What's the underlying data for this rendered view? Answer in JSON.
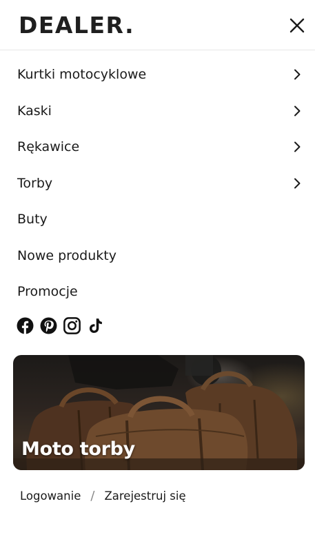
{
  "header": {
    "logo": "DEALER."
  },
  "menu": {
    "items": [
      {
        "label": "Kurtki motocyklowe",
        "has_children": true
      },
      {
        "label": "Kaski",
        "has_children": true
      },
      {
        "label": "Rękawice",
        "has_children": true
      },
      {
        "label": "Torby",
        "has_children": true
      },
      {
        "label": "Buty",
        "has_children": false
      },
      {
        "label": "Nowe produkty",
        "has_children": false
      },
      {
        "label": "Promocje",
        "has_children": false
      }
    ]
  },
  "social": {
    "icons": [
      "facebook-icon",
      "pinterest-icon",
      "instagram-icon",
      "tiktok-icon"
    ]
  },
  "banner": {
    "title": "Moto torby"
  },
  "auth": {
    "login": "Logowanie",
    "separator": "/",
    "register": "Zarejestruj się"
  },
  "colors": {
    "text": "#1a1a1a",
    "background": "#ffffff",
    "divider": "#e6e6e6"
  }
}
